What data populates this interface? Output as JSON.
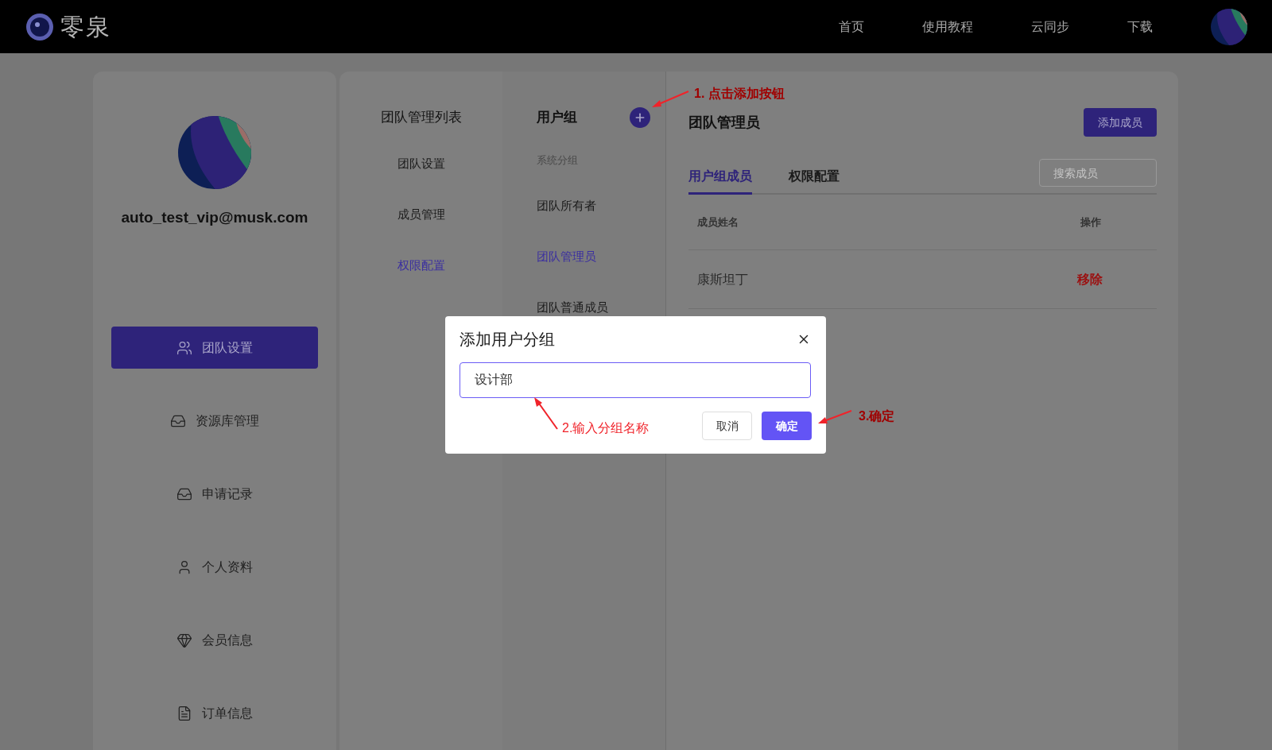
{
  "logo": {
    "text": "零泉"
  },
  "nav": [
    {
      "label": "首页"
    },
    {
      "label": "使用教程"
    },
    {
      "label": "云同步"
    },
    {
      "label": "下载"
    }
  ],
  "profile": {
    "email": "auto_test_vip@musk.com"
  },
  "sidebar": {
    "items": [
      {
        "label": "团队设置",
        "selected": true
      },
      {
        "label": "资源库管理",
        "selected": false
      },
      {
        "label": "申请记录",
        "selected": false
      },
      {
        "label": "个人资料",
        "selected": false
      },
      {
        "label": "会员信息",
        "selected": false
      },
      {
        "label": "订单信息",
        "selected": false
      }
    ]
  },
  "team_menu": {
    "title": "团队管理列表",
    "items": [
      {
        "label": "团队设置",
        "selected": false
      },
      {
        "label": "成员管理",
        "selected": false
      },
      {
        "label": "权限配置",
        "selected": true
      }
    ]
  },
  "user_groups": {
    "title": "用户组",
    "section": "系统分组",
    "items": [
      {
        "label": "团队所有者",
        "selected": false
      },
      {
        "label": "团队管理员",
        "selected": true
      },
      {
        "label": "团队普通成员",
        "selected": false
      }
    ]
  },
  "panel": {
    "title": "团队管理员",
    "add_button": "添加成员",
    "tabs": [
      {
        "label": "用户组成员",
        "selected": true
      },
      {
        "label": "权限配置",
        "selected": false
      }
    ],
    "search": {
      "placeholder": "搜索成员"
    },
    "table": {
      "columns": [
        "成员姓名",
        "操作"
      ],
      "rows": [
        {
          "name": "康斯坦丁",
          "action": "移除"
        }
      ]
    }
  },
  "dialog": {
    "title": "添加用户分组",
    "input": {
      "value": "设计部"
    },
    "buttons": [
      {
        "label": "取消",
        "kind": "secondary"
      },
      {
        "label": "确定",
        "kind": "primary"
      }
    ]
  },
  "annotations": [
    "1. 点击添加按钮",
    "2.输入分组名称",
    "3.确定"
  ]
}
